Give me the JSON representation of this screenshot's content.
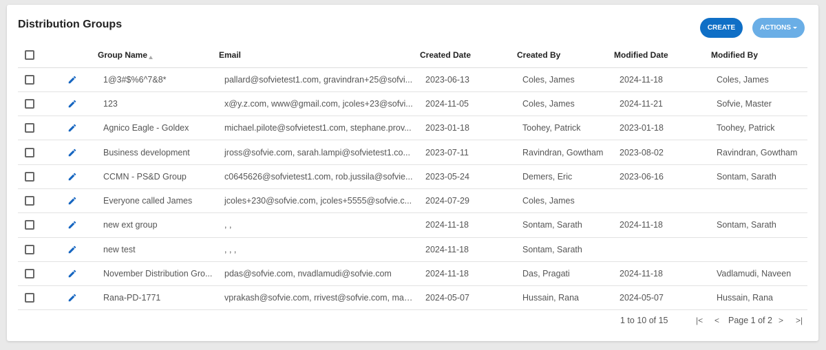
{
  "header": {
    "title": "Distribution Groups",
    "create_label": "CREATE",
    "actions_label": "ACTIONS"
  },
  "colors": {
    "create_button": "#0f6fc6",
    "actions_button": "#6aaee6",
    "edit_icon": "#1565c0"
  },
  "table": {
    "columns": {
      "name": "Group Name",
      "email": "Email",
      "created_date": "Created Date",
      "created_by": "Created By",
      "modified_date": "Modified Date",
      "modified_by": "Modified By"
    },
    "rows": [
      {
        "name": "1@3#$%6^7&8*",
        "email": "pallard@sofvietest1.com, gravindran+25@sofvi...",
        "created_date": "2023-06-13",
        "created_by": "Coles, James",
        "modified_date": "2024-11-18",
        "modified_by": "Coles, James"
      },
      {
        "name": "123",
        "email": "x@y.z.com, www@gmail.com, jcoles+23@sofvi...",
        "created_date": "2024-11-05",
        "created_by": "Coles, James",
        "modified_date": "2024-11-21",
        "modified_by": "Sofvie, Master"
      },
      {
        "name": "Agnico Eagle - Goldex",
        "email": "michael.pilote@sofvietest1.com, stephane.prov...",
        "created_date": "2023-01-18",
        "created_by": "Toohey, Patrick",
        "modified_date": "2023-01-18",
        "modified_by": "Toohey, Patrick"
      },
      {
        "name": "Business development",
        "email": "jross@sofvie.com, sarah.lampi@sofvietest1.co...",
        "created_date": "2023-07-11",
        "created_by": "Ravindran, Gowtham",
        "modified_date": "2023-08-02",
        "modified_by": "Ravindran, Gowtham"
      },
      {
        "name": "CCMN - PS&D Group",
        "email": "c0645626@sofvietest1.com, rob.jussila@sofvie...",
        "created_date": "2023-05-24",
        "created_by": "Demers, Eric",
        "modified_date": "2023-06-16",
        "modified_by": "Sontam, Sarath"
      },
      {
        "name": "Everyone called James",
        "email": "jcoles+230@sofvie.com, jcoles+5555@sofvie.c...",
        "created_date": "2024-07-29",
        "created_by": "Coles, James",
        "modified_date": "",
        "modified_by": ""
      },
      {
        "name": "new ext group",
        "email": ", ,",
        "created_date": "2024-11-18",
        "created_by": "Sontam, Sarath",
        "modified_date": "2024-11-18",
        "modified_by": "Sontam, Sarath"
      },
      {
        "name": "new test",
        "email": ", , ,",
        "created_date": "2024-11-18",
        "created_by": "Sontam, Sarath",
        "modified_date": "",
        "modified_by": ""
      },
      {
        "name": "November Distribution Gro...",
        "email": "pdas@sofvie.com, nvadlamudi@sofvie.com",
        "created_date": "2024-11-18",
        "created_by": "Das, Pragati",
        "modified_date": "2024-11-18",
        "modified_by": "Vadlamudi, Naveen"
      },
      {
        "name": "Rana-PD-1771",
        "email": "vprakash@sofvie.com, rrivest@sofvie.com, mali...",
        "created_date": "2024-05-07",
        "created_by": "Hussain, Rana",
        "modified_date": "2024-05-07",
        "modified_by": "Hussain, Rana"
      }
    ]
  },
  "pagination": {
    "range": "1 to 10 of 15",
    "page_label": "Page 1 of 2",
    "first_icon": "|<",
    "prev_icon": "<",
    "next_icon": ">",
    "last_icon": ">|"
  }
}
